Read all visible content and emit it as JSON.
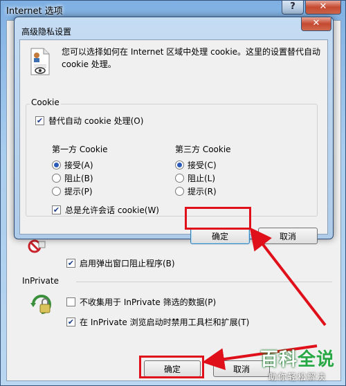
{
  "outer_window": {
    "title": "Internet 选项",
    "help_glyph": "?",
    "close_glyph": "✕",
    "popup_blocker_label": "启用弹出窗口阻止程序(B)",
    "inprivate_heading": "InPrivate",
    "inprivate_no_collect_label": "不收集用于 InPrivate 筛选的数据(P)",
    "inprivate_disable_toolbars_label": "在 InPrivate 浏览启动时禁用工具栏和扩展(T)",
    "ok_label": "确定",
    "cancel_label": "取消"
  },
  "dialog": {
    "title": "高级隐私设置",
    "close_glyph": "✕",
    "description": "您可以选择如何在 Internet 区域中处理 cookie。这里的设置替代自动 cookie 处理。",
    "cookie_group_label": "Cookie",
    "override_label": "替代自动 cookie 处理(O)",
    "first_party": {
      "heading": "第一方 Cookie",
      "options": [
        "接受(A)",
        "阻止(B)",
        "提示(P)"
      ],
      "selected": 0
    },
    "third_party": {
      "heading": "第三方 Cookie",
      "options": [
        "接受(C)",
        "阻止(L)",
        "提示(R)"
      ],
      "selected": 0
    },
    "session_cookie_label": "总是允许会话 cookie(W)",
    "ok_label": "确定",
    "cancel_label": "取消"
  },
  "checkbox_states": {
    "override": true,
    "session_cookie": true,
    "popup_blocker": true,
    "inprivate_no_collect": false,
    "inprivate_disable_toolbars": true
  },
  "watermark": {
    "text_white": "百科",
    "text_green": "全说",
    "subtitle": "助你轻松解决"
  },
  "colors": {
    "annotation_red": "#e0101a",
    "radio_dot": "#2b5bb8"
  }
}
